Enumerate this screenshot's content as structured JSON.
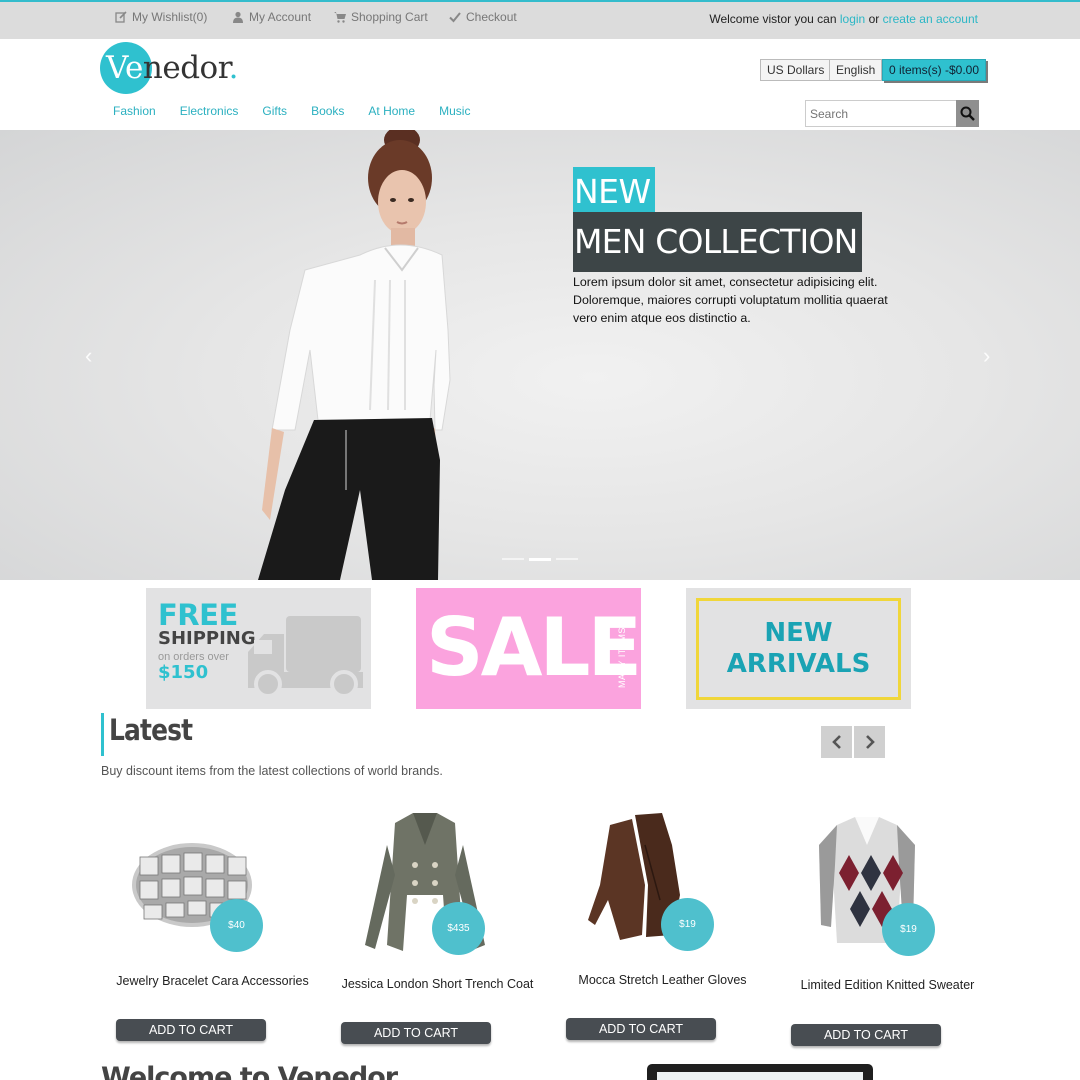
{
  "topbar": {
    "wishlist": "My Wishlist(0)",
    "account": "My Account",
    "cart": "Shopping Cart",
    "checkout": "Checkout",
    "welcome_prefix": "Welcome vistor you can",
    "login": "login",
    "or": "or",
    "create_account": "create an account",
    "icons": [
      "edit-icon",
      "user-icon",
      "cart-icon",
      "check-icon"
    ]
  },
  "header": {
    "logo_ve": "Ve",
    "logo_rest": "nedor",
    "logo_dot": ".",
    "currency": "US Dollars",
    "language": "English",
    "cart_summary": "0 items(s) -$0.00"
  },
  "nav": [
    "Fashion",
    "Electronics",
    "Gifts",
    "Books",
    "At Home",
    "Music"
  ],
  "search": {
    "placeholder": "Search"
  },
  "hero": {
    "badge_new": "NEW",
    "badge_collection": "MEN COLLECTION",
    "description": "Lorem ipsum dolor sit amet, consectetur adipisicing elit. Doloremque, maiores corrupti voluptatum mollitia quaerat vero enim atque eos distinctio a.",
    "prev": "‹",
    "next": "›",
    "slides_total": 3,
    "slide_active": 2
  },
  "promos": {
    "shipping": {
      "free": "FREE",
      "shipping": "SHIPPING",
      "on_orders": "on orders over",
      "price": "$150"
    },
    "sale": {
      "text": "SALE",
      "side": "MANY ITEMS"
    },
    "arrivals": {
      "line1": "NEW",
      "line2": "ARRIVALS"
    }
  },
  "latest": {
    "title": "Latest",
    "subtitle": "Buy discount items from the latest collections of world brands.",
    "products": [
      {
        "name": "Jewelry Bracelet Cara Accessories",
        "price": "$40",
        "add": "ADD TO CART"
      },
      {
        "name": "Jessica London Short Trench Coat",
        "price": "$435",
        "add": "ADD TO CART"
      },
      {
        "name": "Mocca Stretch Leather Gloves",
        "price": "$19",
        "add": "ADD TO CART"
      },
      {
        "name": "Limited Edition Knitted Sweater",
        "price": "$19",
        "add": "ADD TO CART"
      }
    ]
  },
  "welcome": {
    "title": "Welcome to Venedor"
  },
  "colors": {
    "accent": "#2fc1cf",
    "dark": "#3d4547",
    "sale_pink": "#fba3de",
    "button_dark": "#484d52"
  }
}
